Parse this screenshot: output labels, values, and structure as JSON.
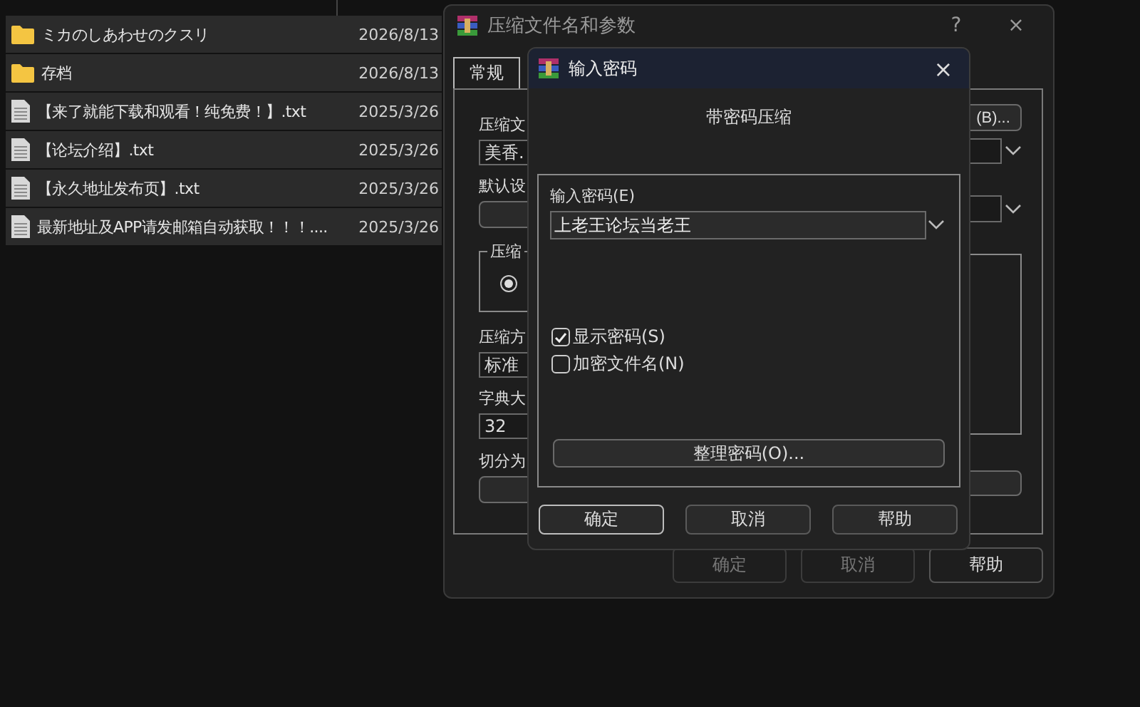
{
  "files": [
    {
      "kind": "folder",
      "name": "ミカのしあわせのクスリ",
      "date": "2026/8/13"
    },
    {
      "kind": "folder",
      "name": "存档",
      "date": "2026/8/13"
    },
    {
      "kind": "file",
      "name": "【来了就能下载和观看！纯免费！】.txt",
      "date": "2025/3/26"
    },
    {
      "kind": "file",
      "name": "【论坛介绍】.txt",
      "date": "2025/3/26"
    },
    {
      "kind": "file",
      "name": "【永久地址发布页】.txt",
      "date": "2025/3/26"
    },
    {
      "kind": "file",
      "name": "最新地址及APP请发邮箱自动获取！！！....",
      "date": "2025/3/26"
    }
  ],
  "archive_window": {
    "title": "压缩文件名和参数",
    "help": "?",
    "close": "×",
    "tabs": [
      {
        "label": "常规",
        "selected": true
      }
    ],
    "left": [
      {
        "kind": "label",
        "text": "压缩文"
      },
      {
        "kind": "field",
        "value": "美香."
      },
      {
        "kind": "label",
        "text": "默认设"
      },
      {
        "kind": "button"
      },
      {
        "kind": "group",
        "legend": "压缩",
        "radio_selected": true
      },
      {
        "kind": "label",
        "text": "压缩方"
      },
      {
        "kind": "field",
        "value": "标准"
      },
      {
        "kind": "label",
        "text": "字典大"
      },
      {
        "kind": "field",
        "value": "32"
      },
      {
        "kind": "label",
        "text": "切分为"
      },
      {
        "kind": "button"
      }
    ],
    "browse_button": "(B)...",
    "buttons": [
      {
        "label": "确定",
        "disabled": true
      },
      {
        "label": "取消",
        "disabled": true
      },
      {
        "label": "帮助",
        "disabled": false
      }
    ]
  },
  "password_dialog": {
    "title": "输入密码",
    "close": "×",
    "heading": "带密码压缩",
    "password_label": "输入密码(E)",
    "password": "上老王论坛当老王",
    "options": [
      {
        "label": "显示密码(S)",
        "checked": true
      },
      {
        "label": "加密文件名(N)",
        "checked": false
      }
    ],
    "manage_button": "整理密码(O)...",
    "buttons": [
      {
        "label": "确定",
        "default": true
      },
      {
        "label": "取消",
        "default": false
      },
      {
        "label": "帮助",
        "default": false
      }
    ]
  }
}
